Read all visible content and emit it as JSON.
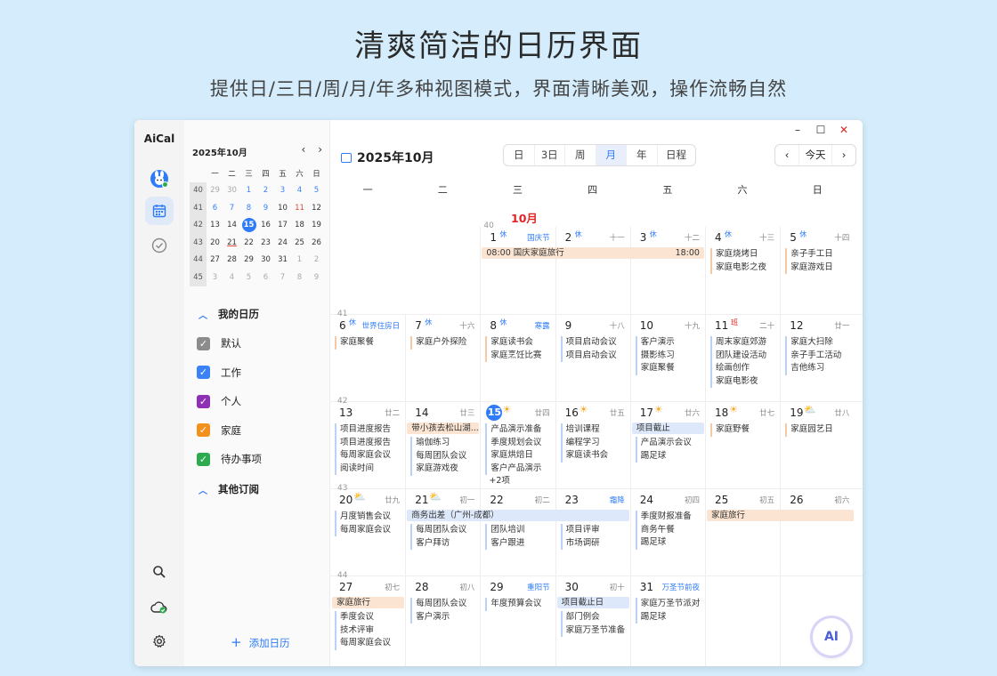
{
  "hero": {
    "title": "清爽简洁的日历界面",
    "subtitle": "提供日/三日/周/月/年多种视图模式，界面清晰美观，操作流畅自然"
  },
  "app": {
    "name": "AiCal"
  },
  "window_controls": {
    "minimize": "–",
    "maximize": "☐",
    "close": "✕"
  },
  "sidebar": {
    "mini_title": "2025年10月",
    "nav_prev": "‹",
    "nav_next": "›",
    "weekday_headers": [
      "一",
      "二",
      "三",
      "四",
      "五",
      "六",
      "日"
    ],
    "weeks": [
      {
        "wk": "40",
        "days": [
          "29",
          "30",
          "1",
          "2",
          "3",
          "4",
          "5"
        ]
      },
      {
        "wk": "41",
        "days": [
          "6",
          "7",
          "8",
          "9",
          "10",
          "11",
          "12"
        ]
      },
      {
        "wk": "42",
        "days": [
          "13",
          "14",
          "15",
          "16",
          "17",
          "18",
          "19"
        ]
      },
      {
        "wk": "43",
        "days": [
          "20",
          "21",
          "22",
          "23",
          "24",
          "25",
          "26"
        ]
      },
      {
        "wk": "44",
        "days": [
          "27",
          "28",
          "29",
          "30",
          "31",
          "1",
          "2"
        ]
      },
      {
        "wk": "45",
        "days": [
          "3",
          "4",
          "5",
          "6",
          "7",
          "8",
          "9"
        ]
      }
    ],
    "my_calendars_label": "我的日历",
    "calendars": [
      {
        "label": "默认",
        "color": "#8c8c8c"
      },
      {
        "label": "工作",
        "color": "#3b82f6"
      },
      {
        "label": "个人",
        "color": "#8e2fb5"
      },
      {
        "label": "家庭",
        "color": "#f2921d"
      },
      {
        "label": "待办事项",
        "color": "#2eaa4f"
      }
    ],
    "other_subscriptions_label": "其他订阅",
    "add_calendar": "添加日历"
  },
  "toolbar": {
    "title": "2025年10月",
    "views": [
      "日",
      "3日",
      "周",
      "月",
      "年",
      "日程"
    ],
    "active_view": "月",
    "prev": "‹",
    "today": "今天",
    "next": "›"
  },
  "weekdays": [
    "一",
    "二",
    "三",
    "四",
    "五",
    "六",
    "日"
  ],
  "month_label": "10月",
  "weeks": [
    {
      "wk": "40",
      "cells": [
        null,
        null,
        {
          "d": "1",
          "badge": "休",
          "lunar": "国庆节",
          "fest": true,
          "events": []
        },
        {
          "d": "2",
          "badge": "休",
          "lunar": "十一",
          "events": []
        },
        {
          "d": "3",
          "badge": "休",
          "lunar": "十二",
          "events": []
        },
        {
          "d": "4",
          "badge": "休",
          "lunar": "十三",
          "events": [
            "家庭烧烤日",
            "家庭电影之夜"
          ],
          "fam": true
        },
        {
          "d": "5",
          "badge": "休",
          "lunar": "十四",
          "events": [
            "亲子手工日",
            "家庭游戏日"
          ],
          "fam": true
        }
      ],
      "bars": [
        {
          "text": "08:00  国庆家庭旅行",
          "right": "18:00",
          "color": "orange",
          "start": 2,
          "span": 3
        }
      ]
    },
    {
      "wk": "41",
      "cells": [
        {
          "d": "6",
          "badge": "休",
          "lunar": "世界住房日",
          "fest": true,
          "events": [
            "家庭聚餐"
          ],
          "fam": true
        },
        {
          "d": "7",
          "badge": "休",
          "lunar": "十六",
          "events": [
            "家庭户外探险"
          ],
          "fam": true
        },
        {
          "d": "8",
          "badge": "休",
          "lunar": "寒露",
          "fest": true,
          "events": [
            "家庭读书会",
            "家庭烹饪比赛"
          ],
          "fam": true
        },
        {
          "d": "9",
          "lunar": "十八",
          "events": [
            "项目启动会议",
            "项目启动会议"
          ]
        },
        {
          "d": "10",
          "lunar": "十九",
          "events": [
            "客户演示",
            "摄影练习",
            "家庭聚餐"
          ]
        },
        {
          "d": "11",
          "badge": "班",
          "badgeRed": true,
          "lunar": "二十",
          "events": [
            "周末家庭郊游",
            "团队建设活动",
            "绘画创作",
            "家庭电影夜"
          ]
        },
        {
          "d": "12",
          "lunar": "廿一",
          "events": [
            "家庭大扫除",
            "亲子手工活动",
            "吉他练习"
          ]
        }
      ],
      "bars": []
    },
    {
      "wk": "42",
      "cells": [
        {
          "d": "13",
          "lunar": "廿二",
          "events": [
            "项目进度报告",
            "项目进度报告",
            "每周家庭会议",
            "阅读时间"
          ]
        },
        {
          "d": "14",
          "lunar": "廿三",
          "events": [
            "瑜伽练习",
            "每周团队会议",
            "家庭游戏夜"
          ]
        },
        {
          "d": "15",
          "today": true,
          "sun": "☀",
          "lunar": "廿四",
          "events": [
            "产品演示准备",
            "季度规划会议",
            "家庭烘焙日",
            "客户产品演示"
          ],
          "more": "+2项"
        },
        {
          "d": "16",
          "sun": "☀",
          "lunar": "廿五",
          "events": [
            "培训课程",
            "编程学习",
            "家庭读书会"
          ]
        },
        {
          "d": "17",
          "sun": "☀",
          "lunar": "廿六",
          "events": [
            "产品演示会议",
            "踢足球"
          ]
        },
        {
          "d": "18",
          "sun": "☀",
          "lunar": "廿七",
          "events": [
            "家庭野餐"
          ],
          "fam": true
        },
        {
          "d": "19",
          "sun": "⛅",
          "lunar": "廿八",
          "events": [
            "家庭园艺日"
          ],
          "fam": true
        }
      ],
      "bars": [
        {
          "text": "带小孩去松山湖...",
          "color": "orange",
          "start": 1,
          "span": 1
        },
        {
          "text": "项目截止",
          "color": "blue",
          "start": 4,
          "span": 1
        }
      ]
    },
    {
      "wk": "43",
      "cells": [
        {
          "d": "20",
          "sun": "⛅",
          "lunar": "廿九",
          "events": [
            "月度销售会议",
            "每周家庭会议"
          ]
        },
        {
          "d": "21",
          "sun": "⛅",
          "lunar": "初一",
          "events": [
            "每周团队会议",
            "客户拜访"
          ]
        },
        {
          "d": "22",
          "lunar": "初二",
          "events": [
            "团队培训",
            "客户跟进"
          ]
        },
        {
          "d": "23",
          "lunar": "霜降",
          "fest": true,
          "events": [
            "项目评审",
            "市场调研"
          ]
        },
        {
          "d": "24",
          "lunar": "初四",
          "events": [
            "季度财报准备",
            "商务午餐",
            "踢足球"
          ]
        },
        {
          "d": "25",
          "lunar": "初五",
          "events": []
        },
        {
          "d": "26",
          "lunar": "初六",
          "events": []
        }
      ],
      "bars": [
        {
          "text": "商务出差（广州-成都）",
          "color": "blue",
          "start": 1,
          "span": 3
        },
        {
          "text": "家庭旅行",
          "color": "orange",
          "start": 5,
          "span": 2
        }
      ]
    },
    {
      "wk": "44",
      "cells": [
        {
          "d": "27",
          "lunar": "初七",
          "events": [
            "季度会议",
            "技术评审",
            "每周家庭会议"
          ]
        },
        {
          "d": "28",
          "lunar": "初八",
          "events": [
            "每周团队会议",
            "客户演示"
          ]
        },
        {
          "d": "29",
          "lunar": "重阳节",
          "fest": true,
          "events": [
            "年度预算会议"
          ]
        },
        {
          "d": "30",
          "lunar": "初十",
          "events": [
            "部门例会",
            "家庭万圣节准备"
          ]
        },
        {
          "d": "31",
          "lunar": "万圣节前夜",
          "fest": true,
          "events": [
            "家庭万圣节派对",
            "踢足球"
          ]
        },
        null,
        null
      ],
      "bars": [
        {
          "text": "家庭旅行",
          "color": "orange",
          "start": 0,
          "span": 1
        },
        {
          "text": "项目截止日",
          "color": "blue",
          "start": 3,
          "span": 1
        }
      ]
    }
  ],
  "ai_button": "AI"
}
